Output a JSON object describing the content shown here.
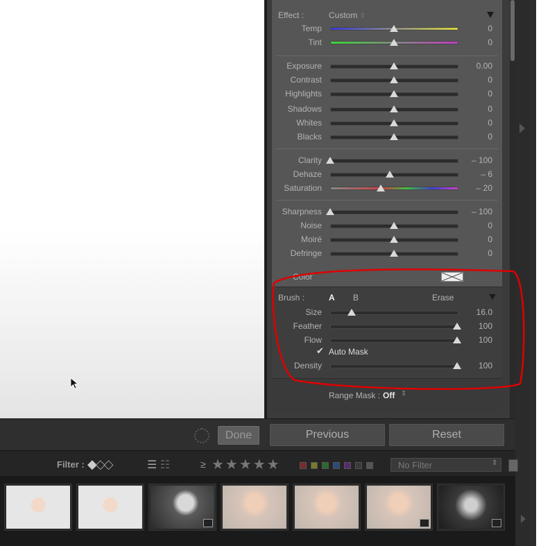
{
  "panel": {
    "effect_label": "Effect :",
    "effect_value": "Custom",
    "sliders": [
      {
        "label": "Temp",
        "value": "0",
        "pos": 0.5,
        "track": "temp"
      },
      {
        "label": "Tint",
        "value": "0",
        "pos": 0.5,
        "track": "tint"
      },
      {
        "label": "Exposure",
        "value": "0.00",
        "pos": 0.5,
        "track": "plain"
      },
      {
        "label": "Contrast",
        "value": "0",
        "pos": 0.5,
        "track": "plain"
      },
      {
        "label": "Highlights",
        "value": "0",
        "pos": 0.5,
        "track": "plain"
      },
      {
        "label": "Shadows",
        "value": "0",
        "pos": 0.5,
        "track": "plain"
      },
      {
        "label": "Whites",
        "value": "0",
        "pos": 0.5,
        "track": "plain"
      },
      {
        "label": "Blacks",
        "value": "0",
        "pos": 0.5,
        "track": "plain"
      },
      {
        "label": "Clarity",
        "value": "– 100",
        "pos": 0.0,
        "track": "plain"
      },
      {
        "label": "Dehaze",
        "value": "– 6",
        "pos": 0.47,
        "track": "plain"
      },
      {
        "label": "Saturation",
        "value": "– 20",
        "pos": 0.4,
        "track": "sat"
      },
      {
        "label": "Sharpness",
        "value": "– 100",
        "pos": 0.0,
        "track": "plain"
      },
      {
        "label": "Noise",
        "value": "0",
        "pos": 0.5,
        "track": "plain"
      },
      {
        "label": "Moiré",
        "value": "0",
        "pos": 0.5,
        "track": "plain"
      },
      {
        "label": "Defringe",
        "value": "0",
        "pos": 0.5,
        "track": "plain"
      }
    ],
    "color_label": "Color"
  },
  "brush": {
    "label": "Brush :",
    "a": "A",
    "b": "B",
    "erase": "Erase",
    "sliders": [
      {
        "label": "Size",
        "value": "16.0",
        "pos": 0.17
      },
      {
        "label": "Feather",
        "value": "100",
        "pos": 1.0
      },
      {
        "label": "Flow",
        "value": "100",
        "pos": 1.0
      }
    ],
    "auto_mask_check": "✔",
    "auto_mask_label": "Auto Mask",
    "density": {
      "label": "Density",
      "value": "100",
      "pos": 1.0
    }
  },
  "range_mask": {
    "label": "Range Mask :",
    "value": "Off"
  },
  "buttons": {
    "done": "Done",
    "previous": "Previous",
    "reset": "Reset"
  },
  "filter": {
    "label": "Filter :",
    "ge": "≥",
    "stars": "★★★★★",
    "preset": "No Filter",
    "color_labels": [
      "#7a2a2a",
      "#7a7a2a",
      "#2a6a2a",
      "#2a4a7a",
      "#5a2a6a",
      "#3a3a3a",
      "#555555"
    ]
  },
  "filmstrip": [
    {
      "style": "t-light",
      "badge": false
    },
    {
      "style": "t-light",
      "badge": false
    },
    {
      "style": "t-bw",
      "badge": true
    },
    {
      "style": "t-warm",
      "badge": false
    },
    {
      "style": "t-warm",
      "badge": false
    },
    {
      "style": "t-warm",
      "badge": true
    },
    {
      "style": "t-dark",
      "badge": true
    }
  ],
  "colors": {
    "annotation_red": "#e00000"
  }
}
